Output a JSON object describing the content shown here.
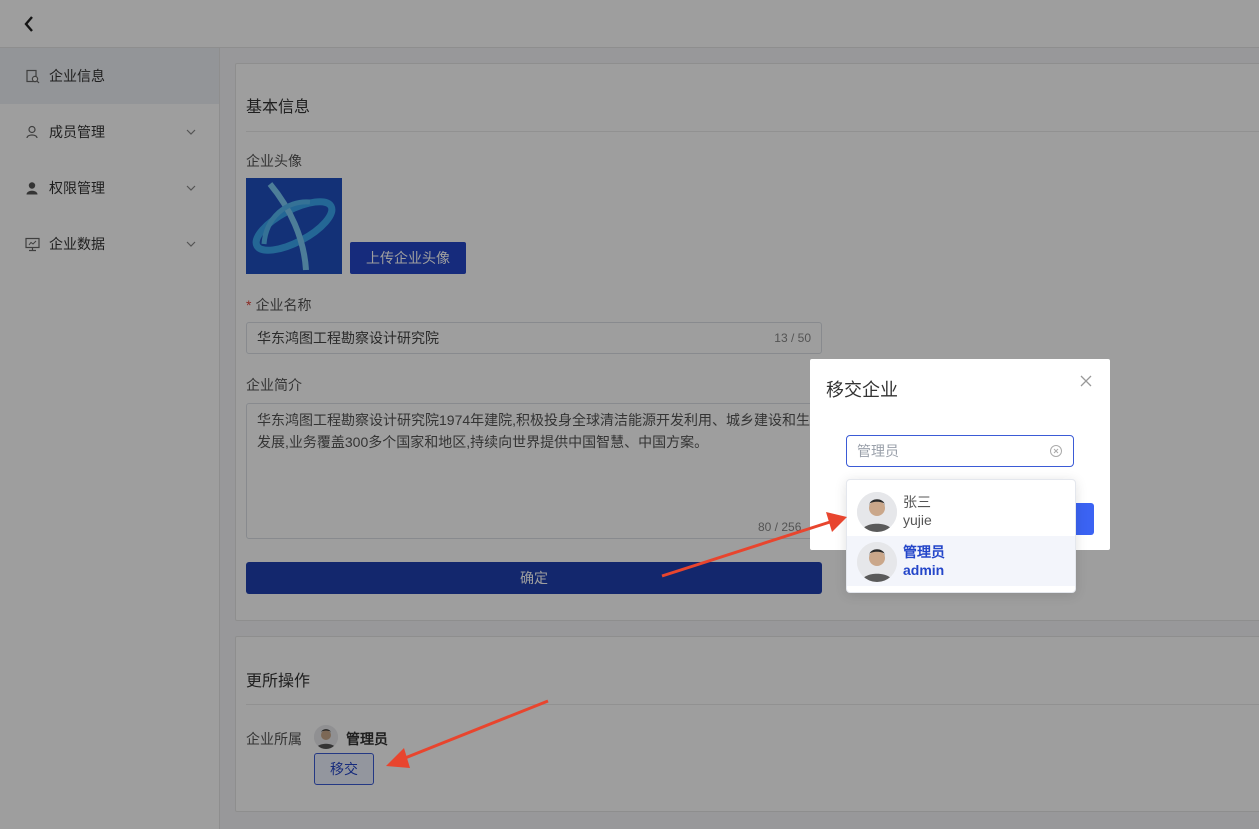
{
  "sidebar": {
    "items": [
      {
        "label": "企业信息",
        "icon": "company-info-icon"
      },
      {
        "label": "成员管理",
        "icon": "user-icon"
      },
      {
        "label": "权限管理",
        "icon": "person-filled-icon"
      },
      {
        "label": "企业数据",
        "icon": "monitor-icon"
      }
    ]
  },
  "basic": {
    "title": "基本信息",
    "avatar_label": "企业头像",
    "upload_label": "上传企业头像",
    "name_label": "企业名称",
    "name_value": "华东鸿图工程勘察设计研究院",
    "name_counter": "13 / 50",
    "intro_label": "企业简介",
    "intro_value": "华东鸿图工程勘察设计研究院1974年建院,积极投身全球清洁能源开发利用、城乡建设和生态环境发展,业务覆盖300多个国家和地区,持续向世界提供中国智慧、中国方案。",
    "intro_counter": "80 / 256",
    "confirm_label": "确定"
  },
  "more": {
    "title": "更所操作",
    "owner_label": "企业所属",
    "owner_name": "管理员",
    "transfer_label": "移交"
  },
  "modal": {
    "title": "移交企业",
    "input_value": "管理员",
    "options": [
      {
        "name": "张三",
        "username": "yujie",
        "selected": false
      },
      {
        "name": "管理员",
        "username": "admin",
        "selected": true
      }
    ]
  },
  "colors": {
    "primary": "#2446c9",
    "arrow": "#e8452e"
  }
}
